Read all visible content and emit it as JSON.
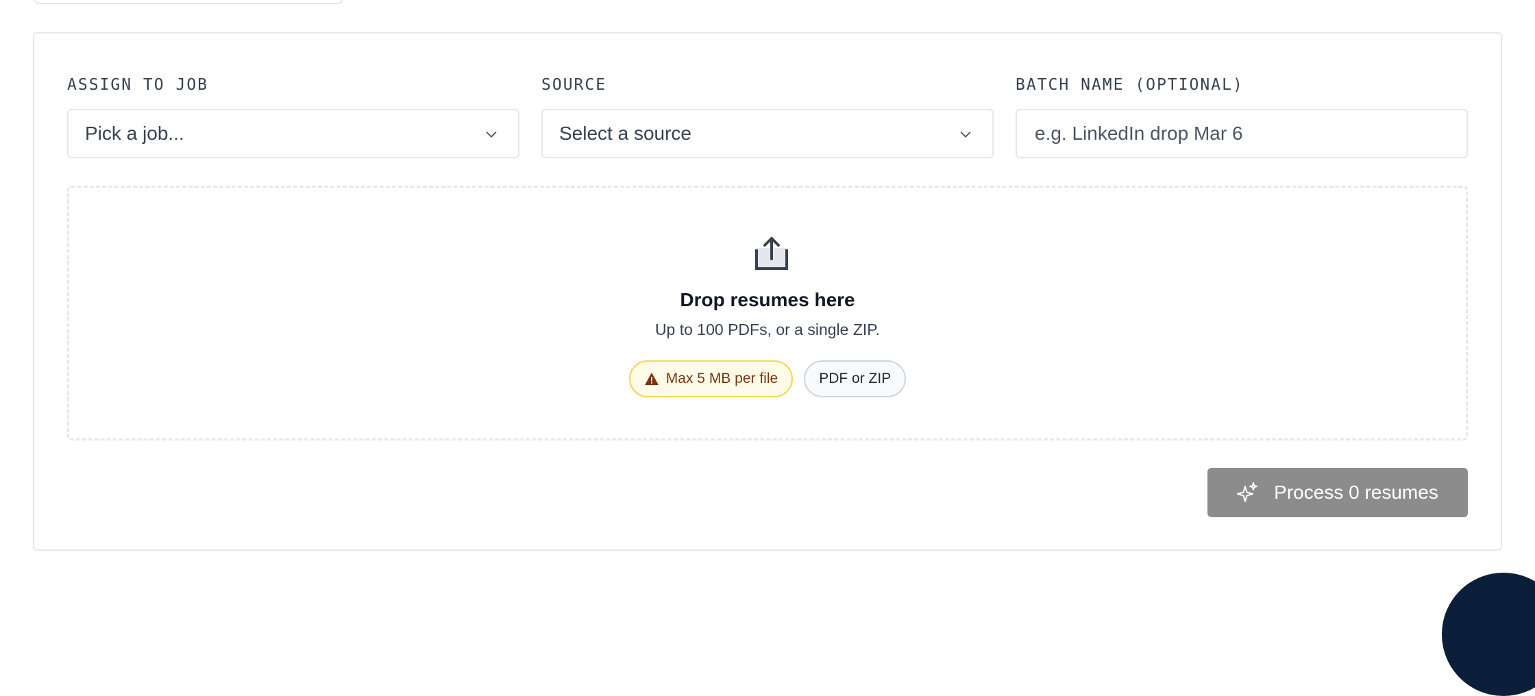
{
  "form": {
    "job": {
      "label": "ASSIGN TO JOB",
      "value": "Pick a job..."
    },
    "source": {
      "label": "SOURCE",
      "value": "Select a source"
    },
    "batch_name": {
      "label": "BATCH NAME (OPTIONAL)",
      "placeholder": "e.g. LinkedIn drop Mar 6"
    }
  },
  "dropzone": {
    "icon": "upload-icon",
    "title": "Drop resumes here",
    "subtitle": "Up to 100 PDFs, or a single ZIP.",
    "pills": {
      "size_limit": "Max 5 MB per file",
      "formats": "PDF or ZIP"
    }
  },
  "actions": {
    "process_label": "Process 0 resumes",
    "process_icon": "sparkle-icon"
  },
  "colors": {
    "button_disabled": "#8c8c8c",
    "warning_bg": "#fefce8",
    "warning_border": "#fcd34d",
    "fab": "#0b1f3a"
  }
}
